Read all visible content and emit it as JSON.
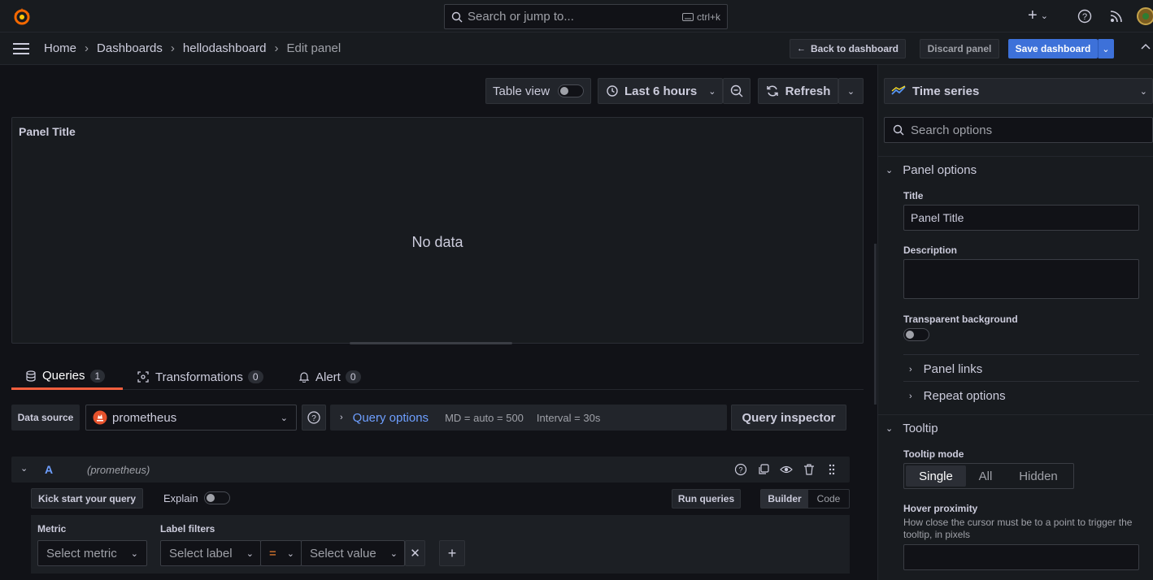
{
  "topbar": {
    "search_placeholder": "Search or jump to...",
    "search_shortcut": "ctrl+k",
    "plus_label": "+"
  },
  "breadcrumb": {
    "items": [
      "Home",
      "Dashboards",
      "hellodashboard",
      "Edit panel"
    ],
    "separator": "›"
  },
  "actions": {
    "back": "Back to dashboard",
    "discard": "Discard panel",
    "save": "Save dashboard"
  },
  "toolbar": {
    "table_view": "Table view",
    "time_range": "Last 6 hours",
    "refresh": "Refresh"
  },
  "panel": {
    "title": "Panel Title",
    "empty": "No data"
  },
  "tabs": [
    {
      "label": "Queries",
      "count": "1"
    },
    {
      "label": "Transformations",
      "count": "0"
    },
    {
      "label": "Alert",
      "count": "0"
    }
  ],
  "datasource": {
    "label": "Data source",
    "value": "prometheus",
    "query_options": "Query options",
    "md": "MD = auto = 500",
    "interval": "Interval = 30s",
    "inspector": "Query inspector"
  },
  "query": {
    "ref": "A",
    "source": "(prometheus)",
    "kick_start": "Kick start your query",
    "explain": "Explain",
    "run": "Run queries",
    "builder": "Builder",
    "code": "Code",
    "metric_label": "Metric",
    "metric_placeholder": "Select metric",
    "label_filters": "Label filters",
    "label_placeholder": "Select label",
    "operator": "=",
    "value_placeholder": "Select value",
    "add": "+"
  },
  "options": {
    "visualization": "Time series",
    "search_placeholder": "Search options",
    "panel_options": "Panel options",
    "title_label": "Title",
    "title_value": "Panel Title",
    "description_label": "Description",
    "transparent_label": "Transparent background",
    "panel_links": "Panel links",
    "repeat_options": "Repeat options",
    "tooltip": "Tooltip",
    "tooltip_mode_label": "Tooltip mode",
    "tooltip_modes": [
      "Single",
      "All",
      "Hidden"
    ],
    "hover_label": "Hover proximity",
    "hover_desc": "How close the cursor must be to a point to trigger the tooltip, in pixels"
  },
  "colors": {
    "accent": "#6e9fff",
    "primary": "#3d71d9",
    "tab_active": "#f55f3e"
  }
}
